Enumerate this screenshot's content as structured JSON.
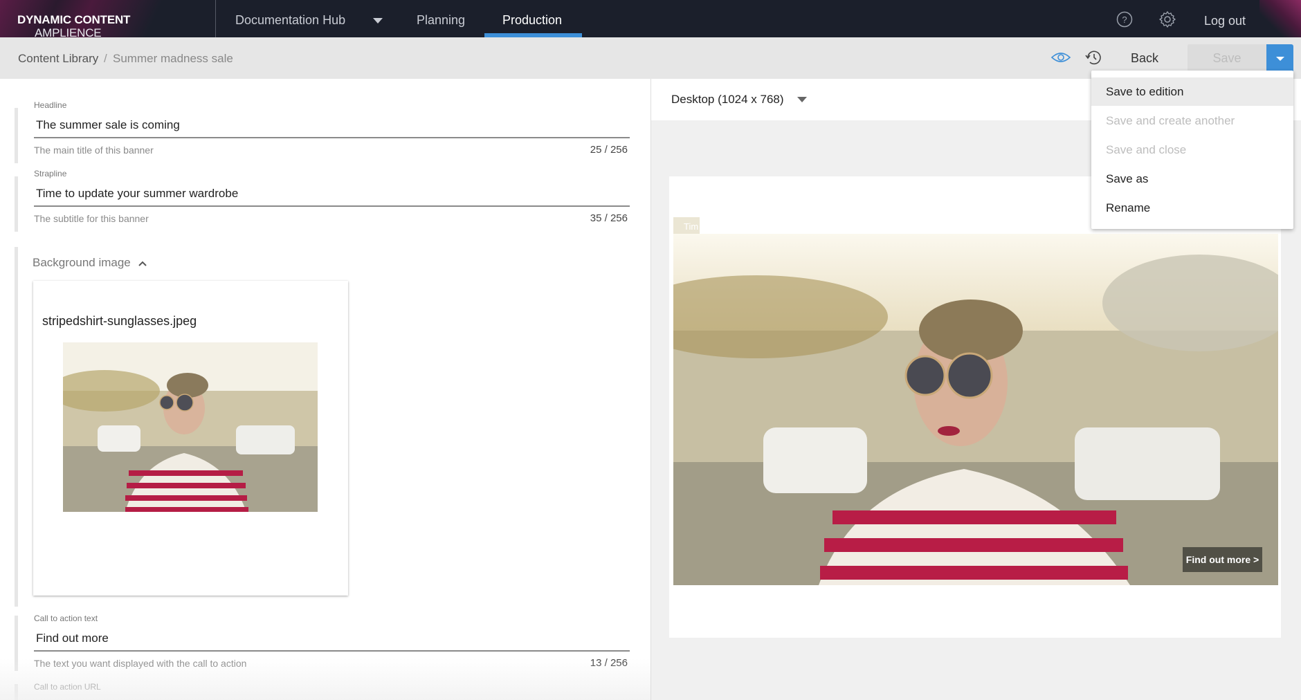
{
  "header": {
    "brand_light": "AMPLIENCE ",
    "brand_bold": "DYNAMIC CONTENT",
    "hub": "Documentation Hub",
    "tabs": [
      {
        "label": "Planning",
        "active": false
      },
      {
        "label": "Production",
        "active": true
      }
    ],
    "logout": "Log out",
    "accent": "#3d8fd8"
  },
  "breadcrumb": {
    "root": "Content Library",
    "separator": "/",
    "current": "Summer madness sale"
  },
  "toolbar": {
    "back": "Back",
    "save": "Save"
  },
  "save_menu": [
    {
      "label": "Save to edition",
      "state": "hover"
    },
    {
      "label": "Save and create another",
      "state": "disabled"
    },
    {
      "label": "Save and close",
      "state": "disabled"
    },
    {
      "label": "Save as",
      "state": "enabled"
    },
    {
      "label": "Rename",
      "state": "enabled"
    }
  ],
  "form": {
    "headline": {
      "label": "Headline",
      "value": "The summer sale is coming",
      "hint": "The main title of this banner",
      "count": "25 / 256"
    },
    "strapline": {
      "label": "Strapline",
      "value": "Time to update your summer wardrobe",
      "hint": "The subtitle for this banner",
      "count": "35 / 256"
    },
    "background": {
      "title": "Background image",
      "asset_name": "stripedshirt-sunglasses.jpeg"
    },
    "cta_text": {
      "label": "Call to action text",
      "value": "Find out more",
      "hint": "The text you want displayed with the call to action",
      "count": "13 / 256"
    },
    "cta_url": {
      "label": "Call to action URL"
    }
  },
  "preview": {
    "device": "Desktop (1024 x 768)",
    "strap_chip": "Tim",
    "cta_badge": "Find out more >"
  }
}
